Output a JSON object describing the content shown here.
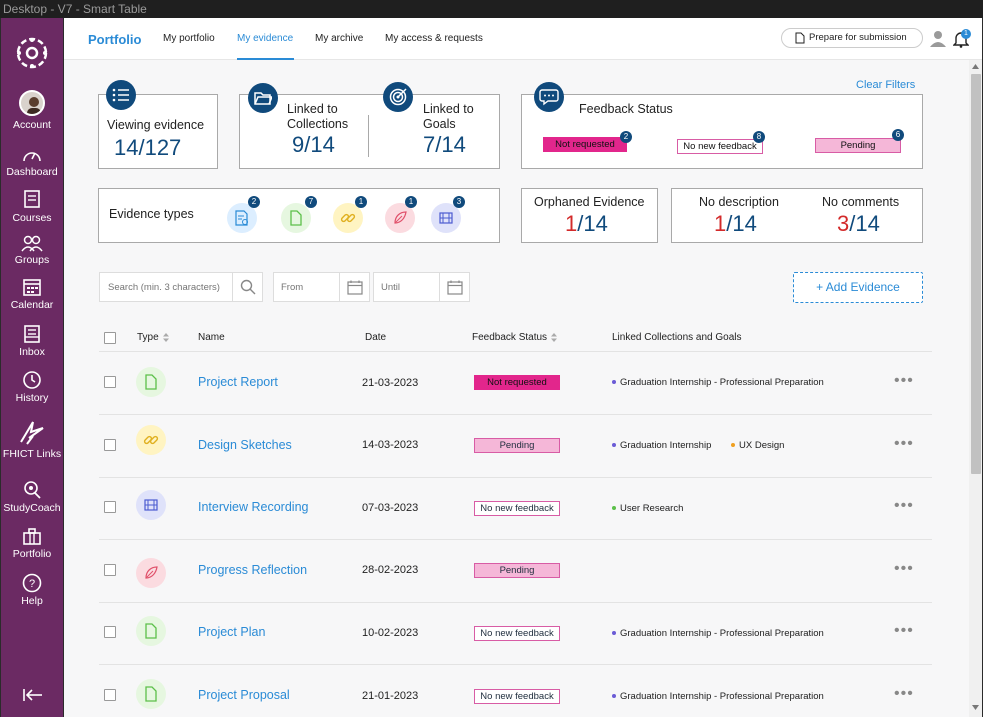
{
  "window": {
    "title": "Desktop - V7 - Smart Table"
  },
  "sidebar": {
    "items": [
      {
        "label": "Account"
      },
      {
        "label": "Dashboard"
      },
      {
        "label": "Courses"
      },
      {
        "label": "Groups"
      },
      {
        "label": "Calendar"
      },
      {
        "label": "Inbox"
      },
      {
        "label": "History"
      },
      {
        "label": "FHICT Links"
      },
      {
        "label": "StudyCoach"
      },
      {
        "label": "Portfolio"
      },
      {
        "label": "Help"
      }
    ]
  },
  "topnav": {
    "brand": "Portfolio",
    "tabs": [
      "My portfolio",
      "My evidence",
      "My archive",
      "My access & requests"
    ],
    "prepare_label": "Prepare for submission",
    "notification_count": "1"
  },
  "summary": {
    "viewing_label": "Viewing evidence",
    "viewing_value": "14/127",
    "collections_label_1": "Linked to",
    "collections_label_2": "Collections",
    "collections_value": "9/14",
    "goals_label_1": "Linked to",
    "goals_label_2": "Goals",
    "goals_value": "7/14",
    "clear_filters": "Clear Filters",
    "feedback_title": "Feedback Status",
    "feedback_tags": [
      {
        "label": "Not requested",
        "count": "2"
      },
      {
        "label": "No new feedback",
        "count": "8"
      },
      {
        "label": "Pending",
        "count": "6"
      }
    ],
    "evidence_types_label": "Evidence types",
    "evidence_type_counts": [
      "2",
      "7",
      "1",
      "1",
      "3"
    ],
    "orphaned_label": "Orphaned Evidence",
    "orphaned_num": "1",
    "orphaned_den": "/14",
    "no_desc_label": "No description",
    "no_desc_num": "1",
    "no_desc_den": "/14",
    "no_comments_label": "No comments",
    "no_comments_num": "3",
    "no_comments_den": "/14"
  },
  "filters": {
    "search_placeholder": "Search (min. 3 characters)",
    "from_placeholder": "From",
    "until_placeholder": "Until",
    "add_label": "+ Add Evidence"
  },
  "table": {
    "headers": {
      "type": "Type",
      "name": "Name",
      "date": "Date",
      "feedback": "Feedback Status",
      "linked": "Linked Collections and Goals"
    },
    "rows": [
      {
        "icon": "document-icon",
        "name": "Project Report",
        "date": "21-03-2023",
        "status": "Not requested",
        "linked": [
          {
            "text": "Graduation Internship - Professional Preparation",
            "color": "#6b5bd6"
          }
        ]
      },
      {
        "icon": "link-icon",
        "name": "Design Sketches",
        "date": "14-03-2023",
        "status": "Pending",
        "linked": [
          {
            "text": "Graduation Internship",
            "color": "#6b5bd6"
          },
          {
            "text": "UX Design",
            "color": "#f0a020"
          }
        ]
      },
      {
        "icon": "video-icon",
        "name": "Interview Recording",
        "date": "07-03-2023",
        "status": "No new feedback",
        "linked": [
          {
            "text": "User Research",
            "color": "#5cc04a"
          }
        ]
      },
      {
        "icon": "feather-icon",
        "name": "Progress Reflection",
        "date": "28-02-2023",
        "status": "Pending",
        "linked": []
      },
      {
        "icon": "document-icon",
        "name": "Project Plan",
        "date": "10-02-2023",
        "status": "No new feedback",
        "linked": [
          {
            "text": "Graduation Internship - Professional Preparation",
            "color": "#6b5bd6"
          }
        ]
      },
      {
        "icon": "document-icon",
        "name": "Project Proposal",
        "date": "21-01-2023",
        "status": "No new feedback",
        "linked": [
          {
            "text": "Graduation Internship - Professional Preparation",
            "color": "#6b5bd6"
          }
        ]
      }
    ],
    "more_label": "•••"
  }
}
